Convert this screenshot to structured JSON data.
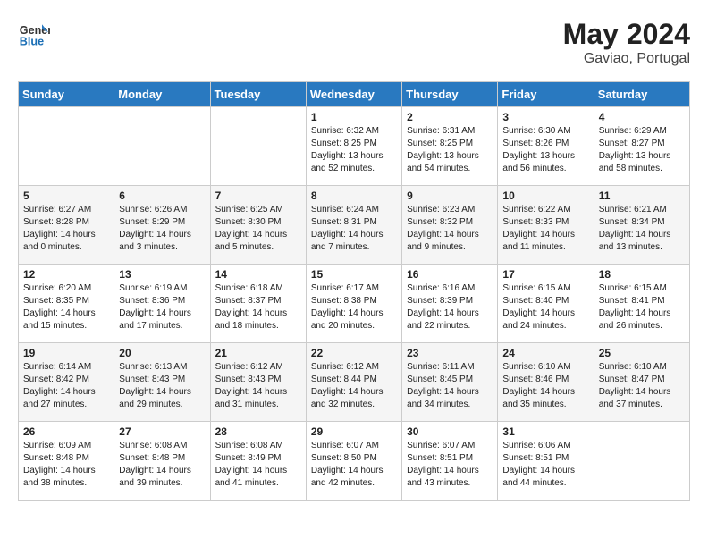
{
  "header": {
    "logo_line1": "General",
    "logo_line2": "Blue",
    "month_year": "May 2024",
    "location": "Gaviao, Portugal"
  },
  "days_of_week": [
    "Sunday",
    "Monday",
    "Tuesday",
    "Wednesday",
    "Thursday",
    "Friday",
    "Saturday"
  ],
  "weeks": [
    [
      {
        "day": "",
        "info": ""
      },
      {
        "day": "",
        "info": ""
      },
      {
        "day": "",
        "info": ""
      },
      {
        "day": "1",
        "info": "Sunrise: 6:32 AM\nSunset: 8:25 PM\nDaylight: 13 hours\nand 52 minutes."
      },
      {
        "day": "2",
        "info": "Sunrise: 6:31 AM\nSunset: 8:25 PM\nDaylight: 13 hours\nand 54 minutes."
      },
      {
        "day": "3",
        "info": "Sunrise: 6:30 AM\nSunset: 8:26 PM\nDaylight: 13 hours\nand 56 minutes."
      },
      {
        "day": "4",
        "info": "Sunrise: 6:29 AM\nSunset: 8:27 PM\nDaylight: 13 hours\nand 58 minutes."
      }
    ],
    [
      {
        "day": "5",
        "info": "Sunrise: 6:27 AM\nSunset: 8:28 PM\nDaylight: 14 hours\nand 0 minutes."
      },
      {
        "day": "6",
        "info": "Sunrise: 6:26 AM\nSunset: 8:29 PM\nDaylight: 14 hours\nand 3 minutes."
      },
      {
        "day": "7",
        "info": "Sunrise: 6:25 AM\nSunset: 8:30 PM\nDaylight: 14 hours\nand 5 minutes."
      },
      {
        "day": "8",
        "info": "Sunrise: 6:24 AM\nSunset: 8:31 PM\nDaylight: 14 hours\nand 7 minutes."
      },
      {
        "day": "9",
        "info": "Sunrise: 6:23 AM\nSunset: 8:32 PM\nDaylight: 14 hours\nand 9 minutes."
      },
      {
        "day": "10",
        "info": "Sunrise: 6:22 AM\nSunset: 8:33 PM\nDaylight: 14 hours\nand 11 minutes."
      },
      {
        "day": "11",
        "info": "Sunrise: 6:21 AM\nSunset: 8:34 PM\nDaylight: 14 hours\nand 13 minutes."
      }
    ],
    [
      {
        "day": "12",
        "info": "Sunrise: 6:20 AM\nSunset: 8:35 PM\nDaylight: 14 hours\nand 15 minutes."
      },
      {
        "day": "13",
        "info": "Sunrise: 6:19 AM\nSunset: 8:36 PM\nDaylight: 14 hours\nand 17 minutes."
      },
      {
        "day": "14",
        "info": "Sunrise: 6:18 AM\nSunset: 8:37 PM\nDaylight: 14 hours\nand 18 minutes."
      },
      {
        "day": "15",
        "info": "Sunrise: 6:17 AM\nSunset: 8:38 PM\nDaylight: 14 hours\nand 20 minutes."
      },
      {
        "day": "16",
        "info": "Sunrise: 6:16 AM\nSunset: 8:39 PM\nDaylight: 14 hours\nand 22 minutes."
      },
      {
        "day": "17",
        "info": "Sunrise: 6:15 AM\nSunset: 8:40 PM\nDaylight: 14 hours\nand 24 minutes."
      },
      {
        "day": "18",
        "info": "Sunrise: 6:15 AM\nSunset: 8:41 PM\nDaylight: 14 hours\nand 26 minutes."
      }
    ],
    [
      {
        "day": "19",
        "info": "Sunrise: 6:14 AM\nSunset: 8:42 PM\nDaylight: 14 hours\nand 27 minutes."
      },
      {
        "day": "20",
        "info": "Sunrise: 6:13 AM\nSunset: 8:43 PM\nDaylight: 14 hours\nand 29 minutes."
      },
      {
        "day": "21",
        "info": "Sunrise: 6:12 AM\nSunset: 8:43 PM\nDaylight: 14 hours\nand 31 minutes."
      },
      {
        "day": "22",
        "info": "Sunrise: 6:12 AM\nSunset: 8:44 PM\nDaylight: 14 hours\nand 32 minutes."
      },
      {
        "day": "23",
        "info": "Sunrise: 6:11 AM\nSunset: 8:45 PM\nDaylight: 14 hours\nand 34 minutes."
      },
      {
        "day": "24",
        "info": "Sunrise: 6:10 AM\nSunset: 8:46 PM\nDaylight: 14 hours\nand 35 minutes."
      },
      {
        "day": "25",
        "info": "Sunrise: 6:10 AM\nSunset: 8:47 PM\nDaylight: 14 hours\nand 37 minutes."
      }
    ],
    [
      {
        "day": "26",
        "info": "Sunrise: 6:09 AM\nSunset: 8:48 PM\nDaylight: 14 hours\nand 38 minutes."
      },
      {
        "day": "27",
        "info": "Sunrise: 6:08 AM\nSunset: 8:48 PM\nDaylight: 14 hours\nand 39 minutes."
      },
      {
        "day": "28",
        "info": "Sunrise: 6:08 AM\nSunset: 8:49 PM\nDaylight: 14 hours\nand 41 minutes."
      },
      {
        "day": "29",
        "info": "Sunrise: 6:07 AM\nSunset: 8:50 PM\nDaylight: 14 hours\nand 42 minutes."
      },
      {
        "day": "30",
        "info": "Sunrise: 6:07 AM\nSunset: 8:51 PM\nDaylight: 14 hours\nand 43 minutes."
      },
      {
        "day": "31",
        "info": "Sunrise: 6:06 AM\nSunset: 8:51 PM\nDaylight: 14 hours\nand 44 minutes."
      },
      {
        "day": "",
        "info": ""
      }
    ]
  ]
}
